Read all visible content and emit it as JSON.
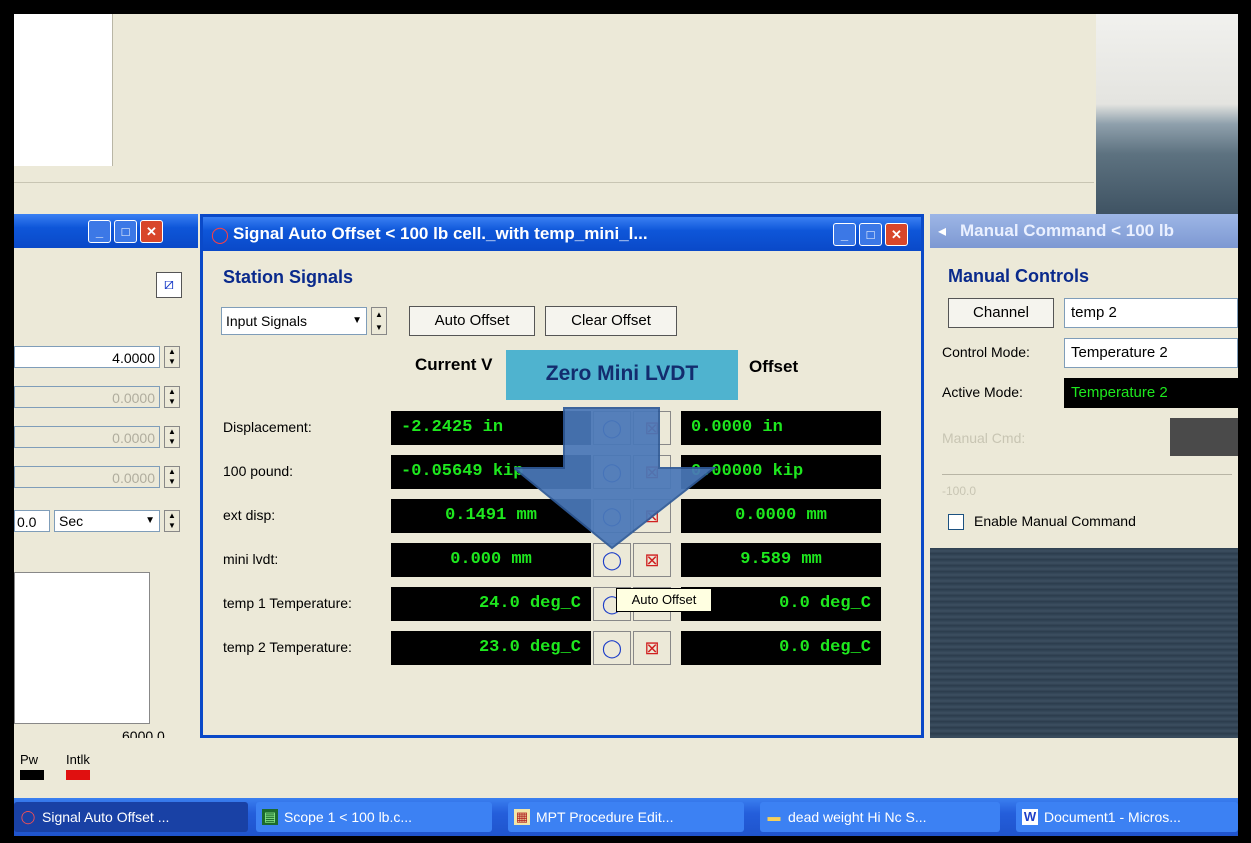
{
  "main_window": {
    "title": "Signal Auto Offset < 100 lb cell._with temp_mini_l...",
    "section_title": "Station Signals",
    "signal_type": "Input Signals",
    "auto_offset_button": "Auto Offset",
    "clear_offset_button": "Clear Offset",
    "col_current": "Current V",
    "col_offset": "Offset",
    "rows": [
      {
        "label": "Displacement:",
        "current": "-2.2425 in",
        "offset": "0.0000 in"
      },
      {
        "label": "100 pound:",
        "current": "-0.05649 kip",
        "offset": "0.00000 kip"
      },
      {
        "label": "ext disp:",
        "current": "0.1491 mm",
        "offset": "0.0000 mm"
      },
      {
        "label": "mini lvdt:",
        "current": "0.000 mm",
        "offset": "9.589 mm"
      },
      {
        "label": "temp 1 Temperature:",
        "current": "24.0 deg_C",
        "offset": "0.0 deg_C"
      },
      {
        "label": "temp 2 Temperature:",
        "current": "23.0 deg_C",
        "offset": "0.0 deg_C"
      }
    ]
  },
  "callout": {
    "text": "Zero Mini LVDT"
  },
  "tooltip": {
    "text": "Auto Offset"
  },
  "left_window": {
    "value_1": "4.0000",
    "value_2": "0.0000",
    "value_3": "0.0000",
    "value_4": "0.0000",
    "time_value": "0.0",
    "time_unit": "Sec",
    "axis_max": "6000.0",
    "legend": [
      "Pw",
      "Intlk"
    ]
  },
  "right_window": {
    "title": "Manual Command < 100 lb",
    "section_title": "Manual Controls",
    "channel_button": "Channel",
    "channel_value": "temp 2",
    "control_mode_label": "Control Mode:",
    "control_mode_value": "Temperature 2",
    "active_mode_label": "Active Mode:",
    "active_mode_value": "Temperature 2",
    "manual_cmd_label": "Manual Cmd:",
    "slider_min": "-100.0",
    "enable_label": "Enable Manual Command"
  },
  "taskbar": [
    {
      "label": "Signal Auto Offset ...",
      "icon": "signal-icon"
    },
    {
      "label": "Scope 1 < 100 lb.c...",
      "icon": "scope-icon"
    },
    {
      "label": "MPT Procedure Edit...",
      "icon": "procedure-icon"
    },
    {
      "label": "dead weight Hi Nc S...",
      "icon": "folder-icon"
    },
    {
      "label": "Document1 - Micros...",
      "icon": "word-icon"
    }
  ],
  "colors": {
    "value_green": "#1ee81e",
    "xp_blue": "#0a49c8",
    "callout": "#4fb3cf",
    "arrow": "#4a78b8"
  }
}
